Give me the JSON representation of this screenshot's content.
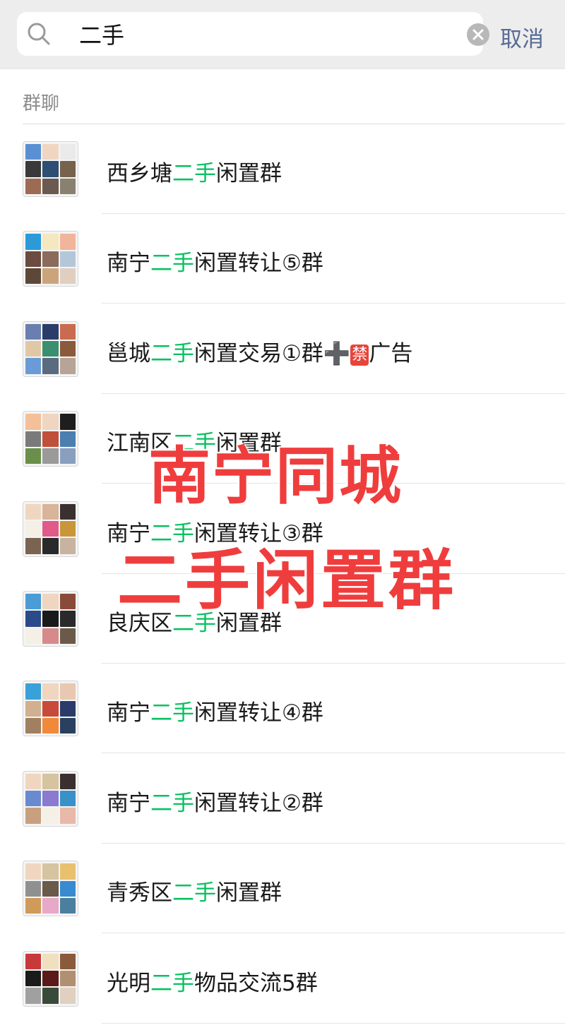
{
  "search": {
    "value": "二手",
    "cancel_label": "取消"
  },
  "section": {
    "title": "群聊"
  },
  "items": [
    {
      "pre": "西乡塘",
      "hl": "二手",
      "post": "闲置群",
      "extra": "",
      "badge": "",
      "tail": "",
      "colors": [
        "#5b8fd3",
        "#f0d6c0",
        "#eaeaea",
        "#3a3a3a",
        "#2c4f73",
        "#77624b",
        "#9d6b54",
        "#6b5a50",
        "#8a8070"
      ]
    },
    {
      "pre": "南宁",
      "hl": "二手",
      "post": "闲置转让⑤群",
      "extra": "",
      "badge": "",
      "tail": "",
      "colors": [
        "#2b9ad7",
        "#f5e7c0",
        "#f0b59a",
        "#6b4a40",
        "#8a6b5c",
        "#b4c7d9",
        "#5d4838",
        "#caa57c",
        "#e0cfc0"
      ]
    },
    {
      "pre": "邕城",
      "hl": "二手",
      "post": "闲置交易①群",
      "extra": "➕",
      "badge": "禁",
      "tail": "广告",
      "colors": [
        "#6a7fb0",
        "#2a3d6a",
        "#c86b4e",
        "#e0c8a6",
        "#3a8f6f",
        "#8b5a3a",
        "#6b9bd6",
        "#5a6b80",
        "#b7a496"
      ]
    },
    {
      "pre": "江南区",
      "hl": "二手",
      "post": "闲置群",
      "extra": "",
      "badge": "",
      "tail": "",
      "colors": [
        "#f3c09a",
        "#f0d6c0",
        "#1e1e1e",
        "#7a7a7a",
        "#c0503a",
        "#4a7fb0",
        "#6b8f4a",
        "#9a9a9a",
        "#8a9fc0"
      ]
    },
    {
      "pre": "南宁",
      "hl": "二手",
      "post": "闲置转让③群",
      "extra": "",
      "badge": "",
      "tail": "",
      "colors": [
        "#f0d6c0",
        "#d8b49a",
        "#3a3030",
        "#f5f0e6",
        "#e05a8a",
        "#c9963a",
        "#7a6450",
        "#2a2a2a",
        "#c7b3a0"
      ]
    },
    {
      "pre": "良庆区",
      "hl": "二手",
      "post": "闲置群",
      "extra": "",
      "badge": "",
      "tail": "",
      "colors": [
        "#4a9bd6",
        "#f0d6c0",
        "#8a4a3a",
        "#2a4a8a",
        "#1a1a1a",
        "#2a2a2a",
        "#f5f0e6",
        "#d68a8a",
        "#6b5a4a"
      ]
    },
    {
      "pre": "南宁",
      "hl": "二手",
      "post": "闲置转让④群",
      "extra": "",
      "badge": "",
      "tail": "",
      "colors": [
        "#3aa0d8",
        "#f0d6c0",
        "#e8c8b0",
        "#d0b090",
        "#c84a3a",
        "#2a3a6a",
        "#a08060",
        "#f08a3a",
        "#2a4060"
      ]
    },
    {
      "pre": "南宁",
      "hl": "二手",
      "post": "闲置转让②群",
      "extra": "",
      "badge": "",
      "tail": "",
      "colors": [
        "#f0d6c0",
        "#d6c3a0",
        "#3a3030",
        "#6a8ad0",
        "#8a7ad0",
        "#3a90c8",
        "#c8a080",
        "#f5f0e6",
        "#e8b8a8"
      ]
    },
    {
      "pre": "青秀区",
      "hl": "二手",
      "post": "闲置群",
      "extra": "",
      "badge": "",
      "tail": "",
      "colors": [
        "#f0d6c0",
        "#d6c3a0",
        "#e8c070",
        "#909090",
        "#6a5a4a",
        "#3a8ad0",
        "#d09a5a",
        "#e8a8c8",
        "#4a7fa0"
      ]
    },
    {
      "pre": "光明",
      "hl": "二手",
      "post": "物品交流5群",
      "extra": "",
      "badge": "",
      "tail": "",
      "colors": [
        "#c83a3a",
        "#f0e0c0",
        "#8a5a3a",
        "#1a1a1a",
        "#5a1a1a",
        "#b09070",
        "#a0a0a0",
        "#3a4a3a",
        "#e0d0c0"
      ]
    }
  ],
  "overlay": {
    "line1": "南宁同城",
    "line2": "二手闲置群"
  }
}
